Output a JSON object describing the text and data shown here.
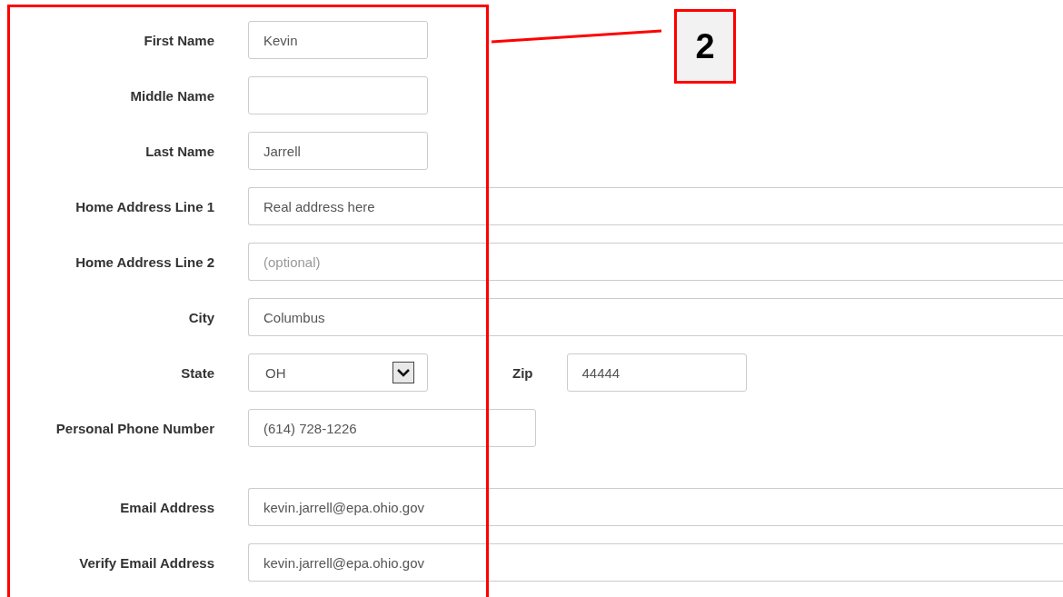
{
  "form": {
    "sections": [
      [
        {
          "label": "First Name",
          "field": {
            "kind": "short",
            "value": "Kevin"
          }
        },
        {
          "label": "Middle Name",
          "field": {
            "kind": "short"
          }
        },
        {
          "label": "Last Name",
          "field": {
            "kind": "short",
            "value": "Jarrell"
          }
        },
        {
          "label": "Home Address Line 1",
          "field": {
            "kind": "long",
            "value": "Real address here"
          }
        },
        {
          "label": "Home Address Line 2",
          "field": {
            "kind": "long",
            "placeholder": "(optional)"
          }
        },
        {
          "label": "City",
          "field": {
            "kind": "long",
            "value": "Columbus"
          }
        },
        {
          "label": "State",
          "field": {
            "kind": "select",
            "value": "OH"
          },
          "side": {
            "label": "Zip",
            "field": {
              "kind": "short",
              "value": "44444"
            }
          }
        },
        {
          "label": "Personal Phone Number",
          "field": {
            "kind": "medium",
            "value": "(614) 728-1226"
          }
        }
      ],
      [
        {
          "label": "Email Address",
          "field": {
            "kind": "long",
            "value": "kevin.jarrell@epa.ohio.gov"
          }
        },
        {
          "label": "Verify Email Address",
          "field": {
            "kind": "long",
            "value": "kevin.jarrell@epa.ohio.gov"
          }
        }
      ]
    ]
  },
  "annotation": {
    "number": "2"
  }
}
